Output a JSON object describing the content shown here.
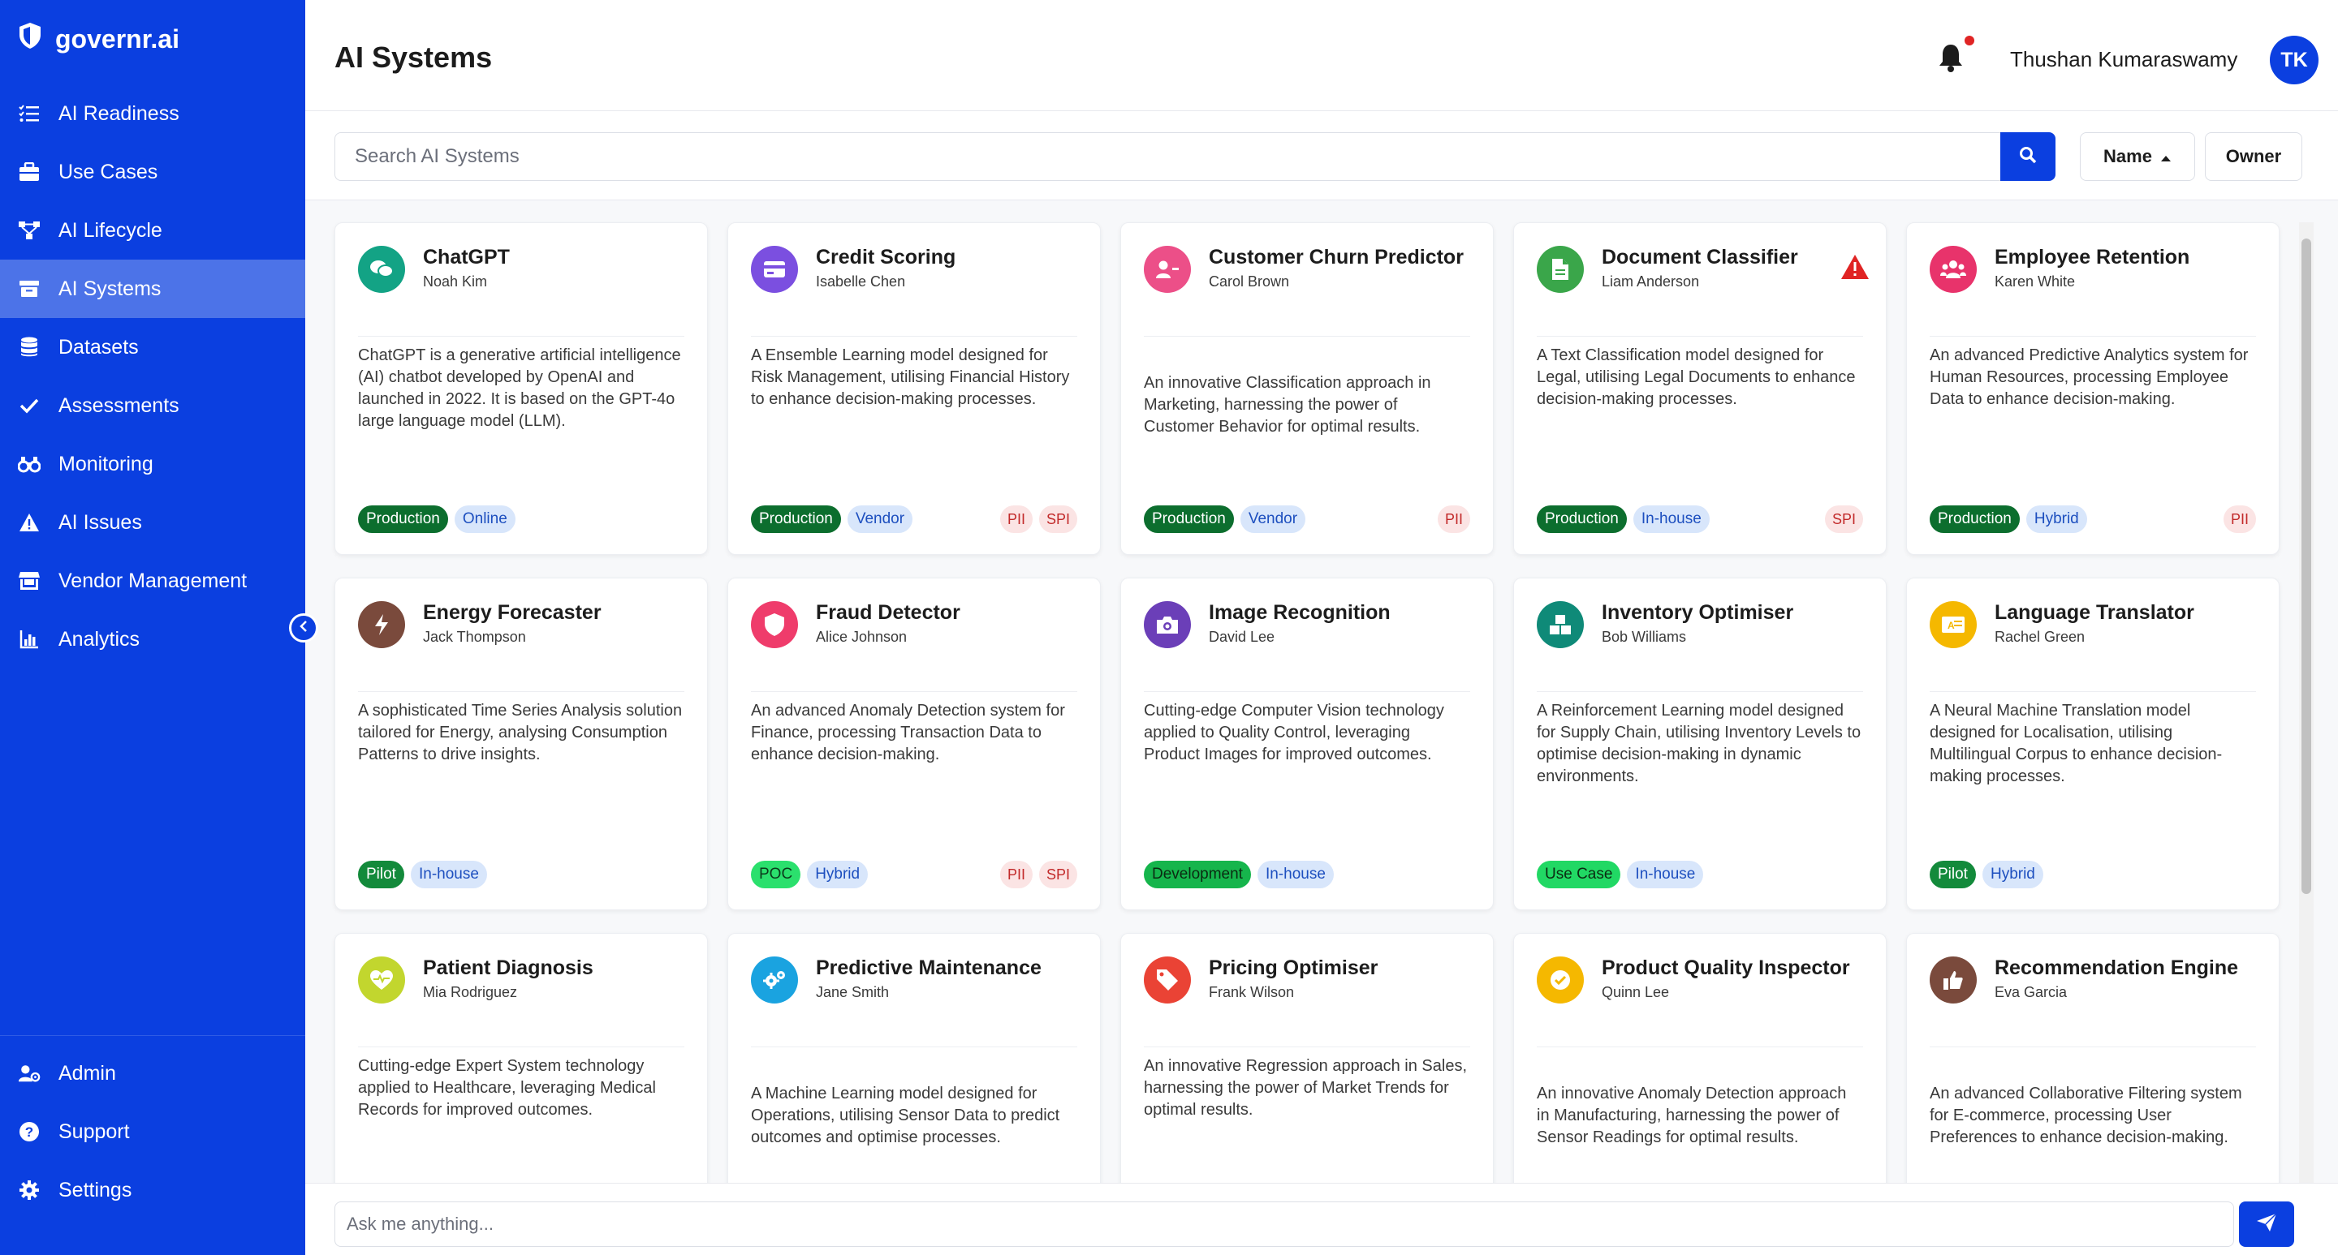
{
  "app": {
    "name": "governr.ai"
  },
  "sidebar": {
    "items": [
      {
        "label": "AI Readiness",
        "icon": "list-check-icon"
      },
      {
        "label": "Use Cases",
        "icon": "briefcase-icon"
      },
      {
        "label": "AI Lifecycle",
        "icon": "flow-icon"
      },
      {
        "label": "AI Systems",
        "icon": "archive-icon",
        "active": true
      },
      {
        "label": "Datasets",
        "icon": "database-icon"
      },
      {
        "label": "Assessments",
        "icon": "check-icon"
      },
      {
        "label": "Monitoring",
        "icon": "binoculars-icon"
      },
      {
        "label": "AI Issues",
        "icon": "warning-icon"
      },
      {
        "label": "Vendor Management",
        "icon": "store-icon"
      },
      {
        "label": "Analytics",
        "icon": "chart-icon"
      }
    ],
    "bottom": [
      {
        "label": "Admin",
        "icon": "users-gear-icon"
      },
      {
        "label": "Support",
        "icon": "question-icon"
      },
      {
        "label": "Settings",
        "icon": "gear-icon"
      }
    ]
  },
  "header": {
    "title": "AI Systems",
    "user_name": "Thushan Kumaraswamy",
    "user_initials": "TK"
  },
  "search": {
    "placeholder": "Search AI Systems",
    "sort_name": "Name",
    "sort_owner": "Owner"
  },
  "chat": {
    "placeholder": "Ask me anything..."
  },
  "colors": {
    "primary": "#0b3fe0",
    "active_nav": "#4c73e8",
    "production": "#0c6e2e",
    "pii": "#c22a2a"
  },
  "cards": [
    {
      "title": "ChatGPT",
      "owner": "Noah Kim",
      "icon_color": "#13a385",
      "icon": "chat-icon",
      "desc": "ChatGPT is a generative artificial intelligence (AI) chatbot developed by OpenAI and launched in 2022. It is based on the GPT-4o large language model (LLM).",
      "stage": "Production",
      "stage_class": "b-prod",
      "source": "Online",
      "flags": []
    },
    {
      "title": "Credit Scoring",
      "owner": "Isabelle Chen",
      "icon_color": "#7b4fe0",
      "icon": "credit-card-icon",
      "desc": "A Ensemble Learning model designed for Risk Management, utilising Financial History to enhance decision-making processes.",
      "stage": "Production",
      "stage_class": "b-prod",
      "source": "Vendor",
      "flags": [
        "PII",
        "SPI"
      ]
    },
    {
      "title": "Customer Churn Predictor",
      "owner": "Carol Brown",
      "icon_color": "#ec4f88",
      "icon": "user-minus-icon",
      "desc": "An innovative Classification approach in Marketing, harnessing the power of Customer Behavior for optimal results.",
      "stage": "Production",
      "stage_class": "b-prod",
      "source": "Vendor",
      "flags": [
        "PII"
      ]
    },
    {
      "title": "Document Classifier",
      "owner": "Liam Anderson",
      "icon_color": "#3aa64a",
      "icon": "file-icon",
      "desc": "A Text Classification model designed for Legal, utilising Legal Documents to enhance decision-making processes.",
      "stage": "Production",
      "stage_class": "b-prod",
      "source": "In-house",
      "flags": [
        "SPI"
      ],
      "warning": true
    },
    {
      "title": "Employee Retention",
      "owner": "Karen White",
      "icon_color": "#e8336b",
      "icon": "users-icon",
      "desc": "An advanced Predictive Analytics system for Human Resources, processing Employee Data to enhance decision-making.",
      "stage": "Production",
      "stage_class": "b-prod",
      "source": "Hybrid",
      "flags": [
        "PII"
      ]
    },
    {
      "title": "Energy Forecaster",
      "owner": "Jack Thompson",
      "icon_color": "#7a4a3c",
      "icon": "bolt-icon",
      "desc": "A sophisticated Time Series Analysis solution tailored for Energy, analysing Consumption Patterns to drive insights.",
      "stage": "Pilot",
      "stage_class": "b-pilot",
      "source": "In-house",
      "flags": []
    },
    {
      "title": "Fraud Detector",
      "owner": "Alice Johnson",
      "icon_color": "#ef3c6b",
      "icon": "shield-icon",
      "desc": "An advanced Anomaly Detection system for Finance, processing Transaction Data to enhance decision-making.",
      "stage": "POC",
      "stage_class": "b-poc",
      "source": "Hybrid",
      "flags": [
        "PII",
        "SPI"
      ]
    },
    {
      "title": "Image Recognition",
      "owner": "David Lee",
      "icon_color": "#6b3fb8",
      "icon": "camera-icon",
      "desc": "Cutting-edge Computer Vision technology applied to Quality Control, leveraging Product Images for improved outcomes.",
      "stage": "Development",
      "stage_class": "b-dev",
      "source": "In-house",
      "flags": []
    },
    {
      "title": "Inventory Optimiser",
      "owner": "Bob Williams",
      "icon_color": "#0f8a78",
      "icon": "boxes-icon",
      "desc": "A Reinforcement Learning model designed for Supply Chain, utilising Inventory Levels to optimise decision-making in dynamic environments.",
      "stage": "Use Case",
      "stage_class": "b-use",
      "source": "In-house",
      "flags": []
    },
    {
      "title": "Language Translator",
      "owner": "Rachel Green",
      "icon_color": "#f5b800",
      "icon": "language-icon",
      "desc": "A Neural Machine Translation model designed for Localisation, utilising Multilingual Corpus to enhance decision-making processes.",
      "stage": "Pilot",
      "stage_class": "b-pilot",
      "source": "Hybrid",
      "flags": []
    },
    {
      "title": "Patient Diagnosis",
      "owner": "Mia Rodriguez",
      "icon_color": "#c2d62e",
      "icon": "heart-pulse-icon",
      "desc": "Cutting-edge Expert System technology applied to Healthcare, leveraging Medical Records for improved outcomes.",
      "stage": "",
      "stage_class": "",
      "source": "",
      "flags": []
    },
    {
      "title": "Predictive Maintenance",
      "owner": "Jane Smith",
      "icon_color": "#1aa3e0",
      "icon": "cogs-icon",
      "desc": "A Machine Learning model designed for Operations, utilising Sensor Data to predict outcomes and optimise processes.",
      "stage": "",
      "stage_class": "",
      "source": "",
      "flags": []
    },
    {
      "title": "Pricing Optimiser",
      "owner": "Frank Wilson",
      "icon_color": "#ea4335",
      "icon": "tag-icon",
      "desc": "An innovative Regression approach in Sales, harnessing the power of Market Trends for optimal results.",
      "stage": "",
      "stage_class": "",
      "source": "",
      "flags": []
    },
    {
      "title": "Product Quality Inspector",
      "owner": "Quinn Lee",
      "icon_color": "#f5b800",
      "icon": "check-circle-icon",
      "desc": "An innovative Anomaly Detection approach in Manufacturing, harnessing the power of Sensor Readings for optimal results.",
      "stage": "",
      "stage_class": "",
      "source": "",
      "flags": []
    },
    {
      "title": "Recommendation Engine",
      "owner": "Eva Garcia",
      "icon_color": "#7a4a3c",
      "icon": "thumbs-up-icon",
      "desc": "An advanced Collaborative Filtering system for E-commerce, processing User Preferences to enhance decision-making.",
      "stage": "",
      "stage_class": "",
      "source": "",
      "flags": []
    }
  ]
}
